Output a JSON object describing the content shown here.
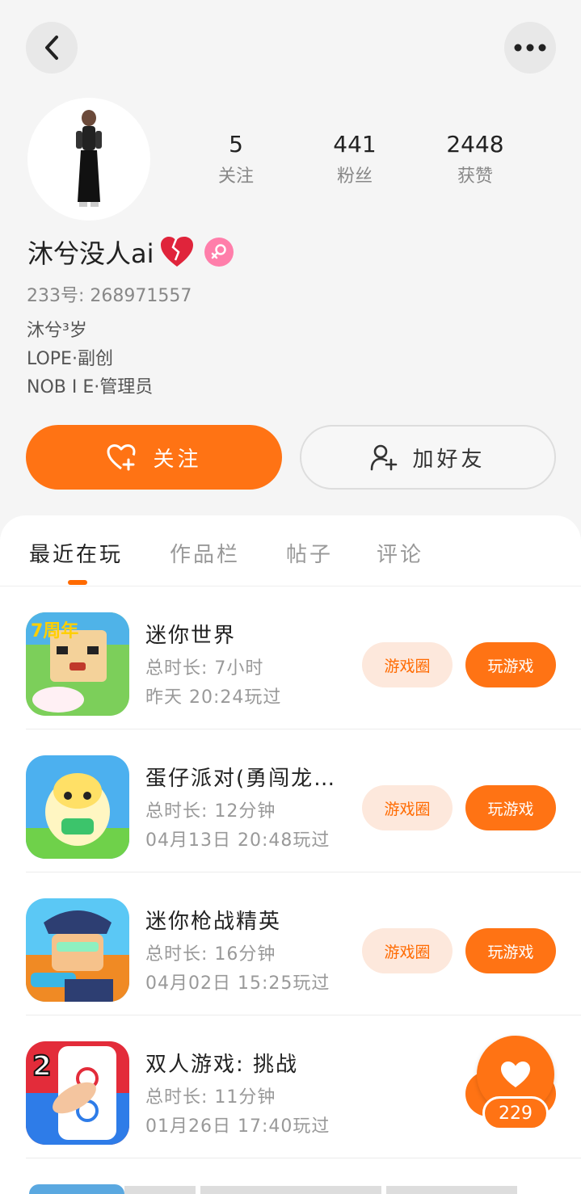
{
  "profile": {
    "nickname": "沐兮没人ai",
    "uid_text": "233号: 268971557",
    "bio_lines": [
      "沐兮³岁",
      "LOPE·副创",
      "NOB I E·管理员"
    ],
    "stats": [
      {
        "value": "5",
        "label": "关注"
      },
      {
        "value": "441",
        "label": "粉丝"
      },
      {
        "value": "2448",
        "label": "获赞"
      }
    ]
  },
  "actions": {
    "follow_label": "关注",
    "add_friend_label": "加好友"
  },
  "tabs": [
    {
      "label": "最近在玩",
      "active": true
    },
    {
      "label": "作品栏",
      "active": false
    },
    {
      "label": "帖子",
      "active": false
    },
    {
      "label": "评论",
      "active": false
    }
  ],
  "games": [
    {
      "title": "迷你世界",
      "duration": "总时长: 7小时",
      "last_played": "昨天 20:24玩过",
      "circle_label": "游戏圈",
      "play_label": "玩游戏"
    },
    {
      "title": "蛋仔派对(勇闯龙…",
      "duration": "总时长: 12分钟",
      "last_played": "04月13日 20:48玩过",
      "circle_label": "游戏圈",
      "play_label": "玩游戏"
    },
    {
      "title": "迷你枪战精英",
      "duration": "总时长: 16分钟",
      "last_played": "04月02日 15:25玩过",
      "circle_label": "游戏圈",
      "play_label": "玩游戏"
    },
    {
      "title": "双人游戏: 挑战",
      "duration": "总时长: 11分钟",
      "last_played": "01月26日 17:40玩过",
      "circle_label": "",
      "play_label": ""
    }
  ],
  "like_fab": {
    "count": "229"
  },
  "colors": {
    "accent": "#ff7314",
    "gender_badge": "#ff7eaa"
  },
  "icons": [
    "back-arrow-icon",
    "more-dots-icon",
    "heart-plus-icon",
    "add-user-icon",
    "heart-icon",
    "female-icon"
  ]
}
